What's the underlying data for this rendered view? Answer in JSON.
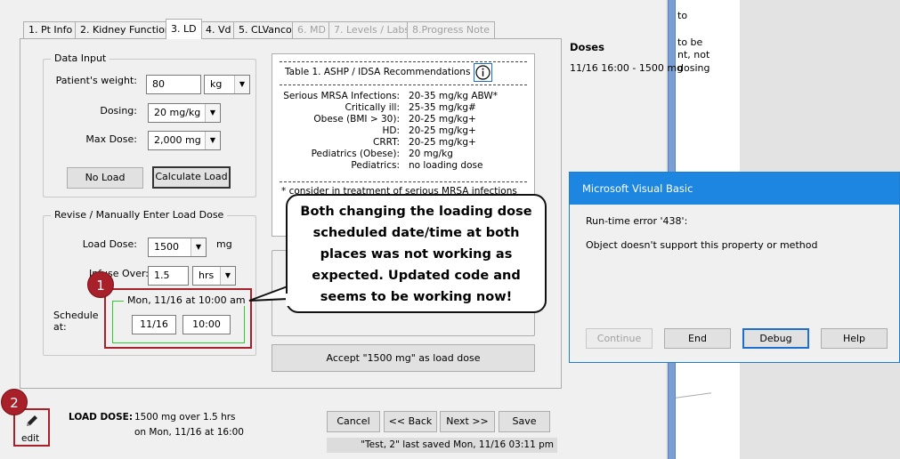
{
  "tabs": [
    {
      "label": "1. Pt Info",
      "state": "normal"
    },
    {
      "label": "2. Kidney Function",
      "state": "normal"
    },
    {
      "label": "3. LD",
      "state": "active"
    },
    {
      "label": "4. Vd",
      "state": "normal"
    },
    {
      "label": "5. CLVanco",
      "state": "normal"
    },
    {
      "label": "6. MD",
      "state": "disabled"
    },
    {
      "label": "7. Levels / Labs",
      "state": "disabled"
    },
    {
      "label": "8.Progress Note",
      "state": "disabled"
    }
  ],
  "data_input": {
    "title": "Data Input",
    "weight_label": "Patient's weight:",
    "weight_value": "80",
    "weight_unit": "kg",
    "dosing_label": "Dosing:",
    "dosing_value": "20 mg/kg",
    "max_dose_label": "Max Dose:",
    "max_dose_value": "2,000 mg",
    "no_load_button": "No Load",
    "calculate_load_button": "Calculate Load"
  },
  "revise": {
    "title": "Revise / Manually Enter Load Dose",
    "load_dose_label": "Load Dose:",
    "load_dose_value": "1500",
    "load_dose_unit": "mg",
    "infuse_label": "Infuse Over:",
    "infuse_value": "1.5",
    "infuse_unit": "hrs",
    "schedule_label": "Schedule at:",
    "schedule_group_title": "Mon, 11/16 at 10:00 am",
    "date_value": "11/16",
    "time_value": "10:00"
  },
  "recommendations": {
    "title": "Table 1.  ASHP / IDSA Recommendations",
    "info_icon": "info-circle-icon",
    "rows": [
      {
        "k": "Serious MRSA Infections:",
        "v": "20-35 mg/kg ABW*"
      },
      {
        "k": "Critically ill:",
        "v": "25-35 mg/kg#"
      },
      {
        "k": "Obese (BMI > 30):",
        "v": "20-25 mg/kg+"
      },
      {
        "k": "HD:",
        "v": "20-25 mg/kg+"
      },
      {
        "k": "CRRT:",
        "v": "20-25 mg/kg+"
      },
      {
        "k": "Pediatrics (Obese):",
        "v": "20 mg/kg"
      },
      {
        "k": "Pediatrics:",
        "v": "no loading dose"
      }
    ],
    "footnote": "* consider in treatment of serious MRSA infections"
  },
  "accept_button": "Accept \"1500 mg\" as load dose",
  "callout_text": "Both changing the loading dose scheduled date/time at both places was not working as expected.  Updated code and seems to be working now!",
  "badges": [
    "1",
    "2"
  ],
  "edit": {
    "label": "edit",
    "icon": "pencil-icon"
  },
  "load_dose_summary": {
    "label": "LOAD DOSE:",
    "line1": "1500 mg over 1.5 hrs",
    "line2": "on Mon, 11/16 at 16:00"
  },
  "nav_buttons": {
    "cancel": "Cancel",
    "back": "<< Back",
    "next": "Next >>",
    "save": "Save"
  },
  "status_text": "\"Test, 2\" last saved Mon, 11/16 03:11 pm",
  "doses": {
    "title": "Doses",
    "entry": "11/16 16:00 - 1500 mg"
  },
  "doc_fragments": [
    "to",
    "to be",
    "nt, not",
    "dosing"
  ],
  "dialog": {
    "title": "Microsoft Visual Basic",
    "error_line": "Run-time error '438':",
    "message": "Object doesn't support this property or method",
    "buttons": {
      "continue": "Continue",
      "end": "End",
      "debug": "Debug",
      "help": "Help"
    }
  },
  "colors": {
    "badge": "#a8202a",
    "highlight_border": "#a8202a",
    "schedule_box": "#33cc33",
    "dialog_title_bar": "#1c86e0",
    "blue_strip": "#7a9fd3"
  }
}
